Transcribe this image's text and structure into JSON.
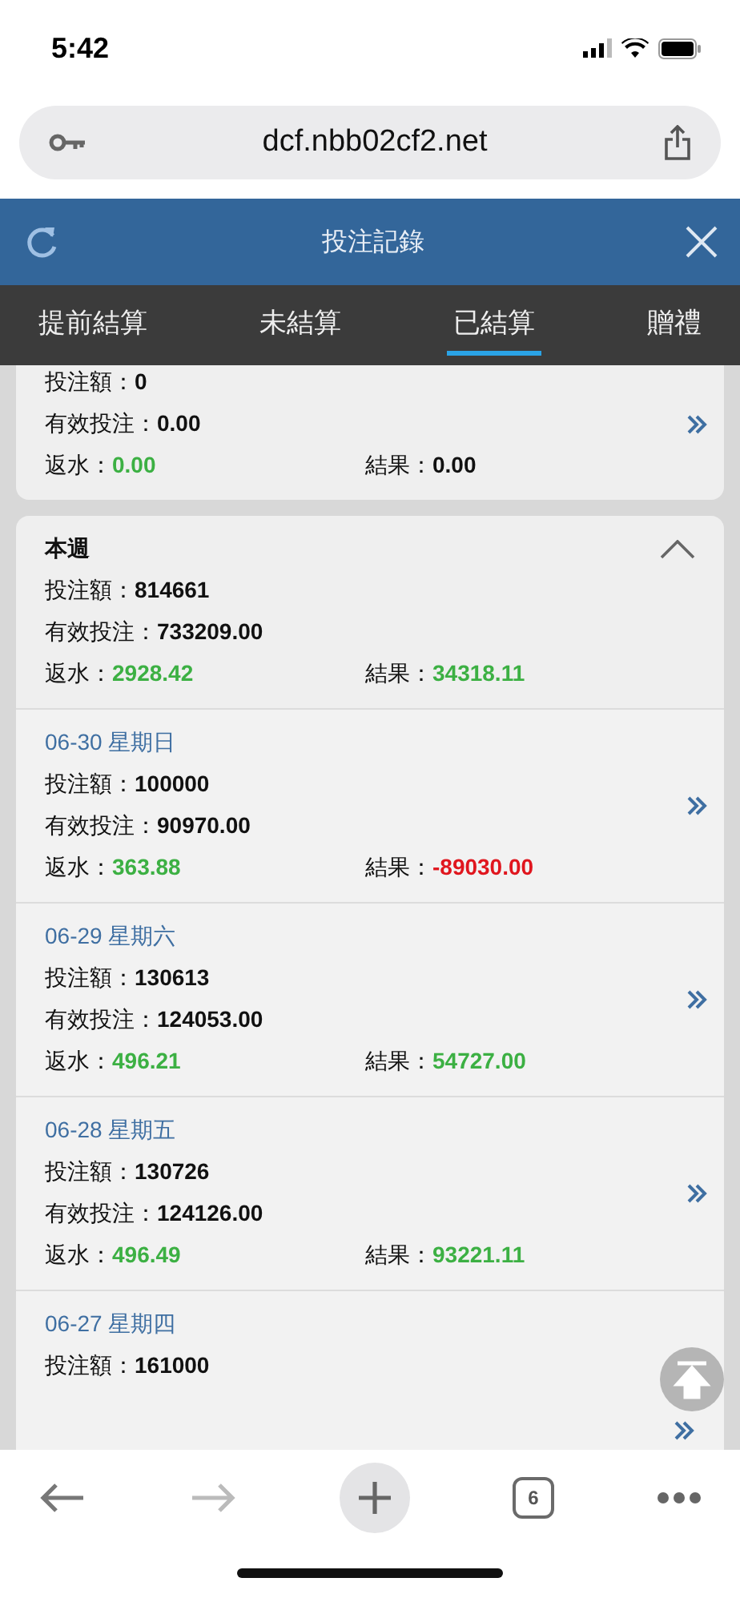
{
  "status_bar": {
    "time": "5:42"
  },
  "address_bar": {
    "url": "dcf.nbb02cf2.net"
  },
  "header": {
    "title": "投注記錄"
  },
  "tabs": [
    {
      "label": "提前結算",
      "selected": false
    },
    {
      "label": "未結算",
      "selected": false
    },
    {
      "label": "已結算",
      "selected": true
    },
    {
      "label": "贈禮",
      "selected": false
    }
  ],
  "summary_card": {
    "stake_label": "投注額：",
    "stake": "0",
    "valid_label": "有效投注：",
    "valid": "0.00",
    "rebate_label": "返水：",
    "rebate": "0.00",
    "result_label": "結果：",
    "result": "0.00",
    "color": "#111111"
  },
  "week": {
    "title": "本週",
    "expanded": true,
    "stake_label": "投注額：",
    "stake": "814661",
    "valid_label": "有效投注：",
    "valid": "733209.00",
    "rebate_label": "返水：",
    "rebate": "2928.42",
    "result_label": "結果：",
    "result": "34318.11",
    "color": "#3cb043",
    "days": [
      {
        "date": "06-30 星期日",
        "stake_label": "投注額：",
        "stake": "100000",
        "valid_label": "有效投注：",
        "valid": "90970.00",
        "rebate_label": "返水：",
        "rebate": "363.88",
        "result_label": "結果：",
        "result": "-89030.00",
        "color": "#e0161e"
      },
      {
        "date": "06-29 星期六",
        "stake_label": "投注額：",
        "stake": "130613",
        "valid_label": "有效投注：",
        "valid": "124053.00",
        "rebate_label": "返水：",
        "rebate": "496.21",
        "result_label": "結果：",
        "result": "54727.00",
        "color": "#3cb043"
      },
      {
        "date": "06-28 星期五",
        "stake_label": "投注額：",
        "stake": "130726",
        "valid_label": "有效投注：",
        "valid": "124126.00",
        "rebate_label": "返水：",
        "rebate": "496.49",
        "result_label": "結果：",
        "result": "93221.11",
        "color": "#3cb043"
      },
      {
        "date": "06-27 星期四",
        "stake_label": "投注額：",
        "stake": "161000"
      }
    ]
  },
  "toolbar": {
    "tab_count": "6"
  }
}
